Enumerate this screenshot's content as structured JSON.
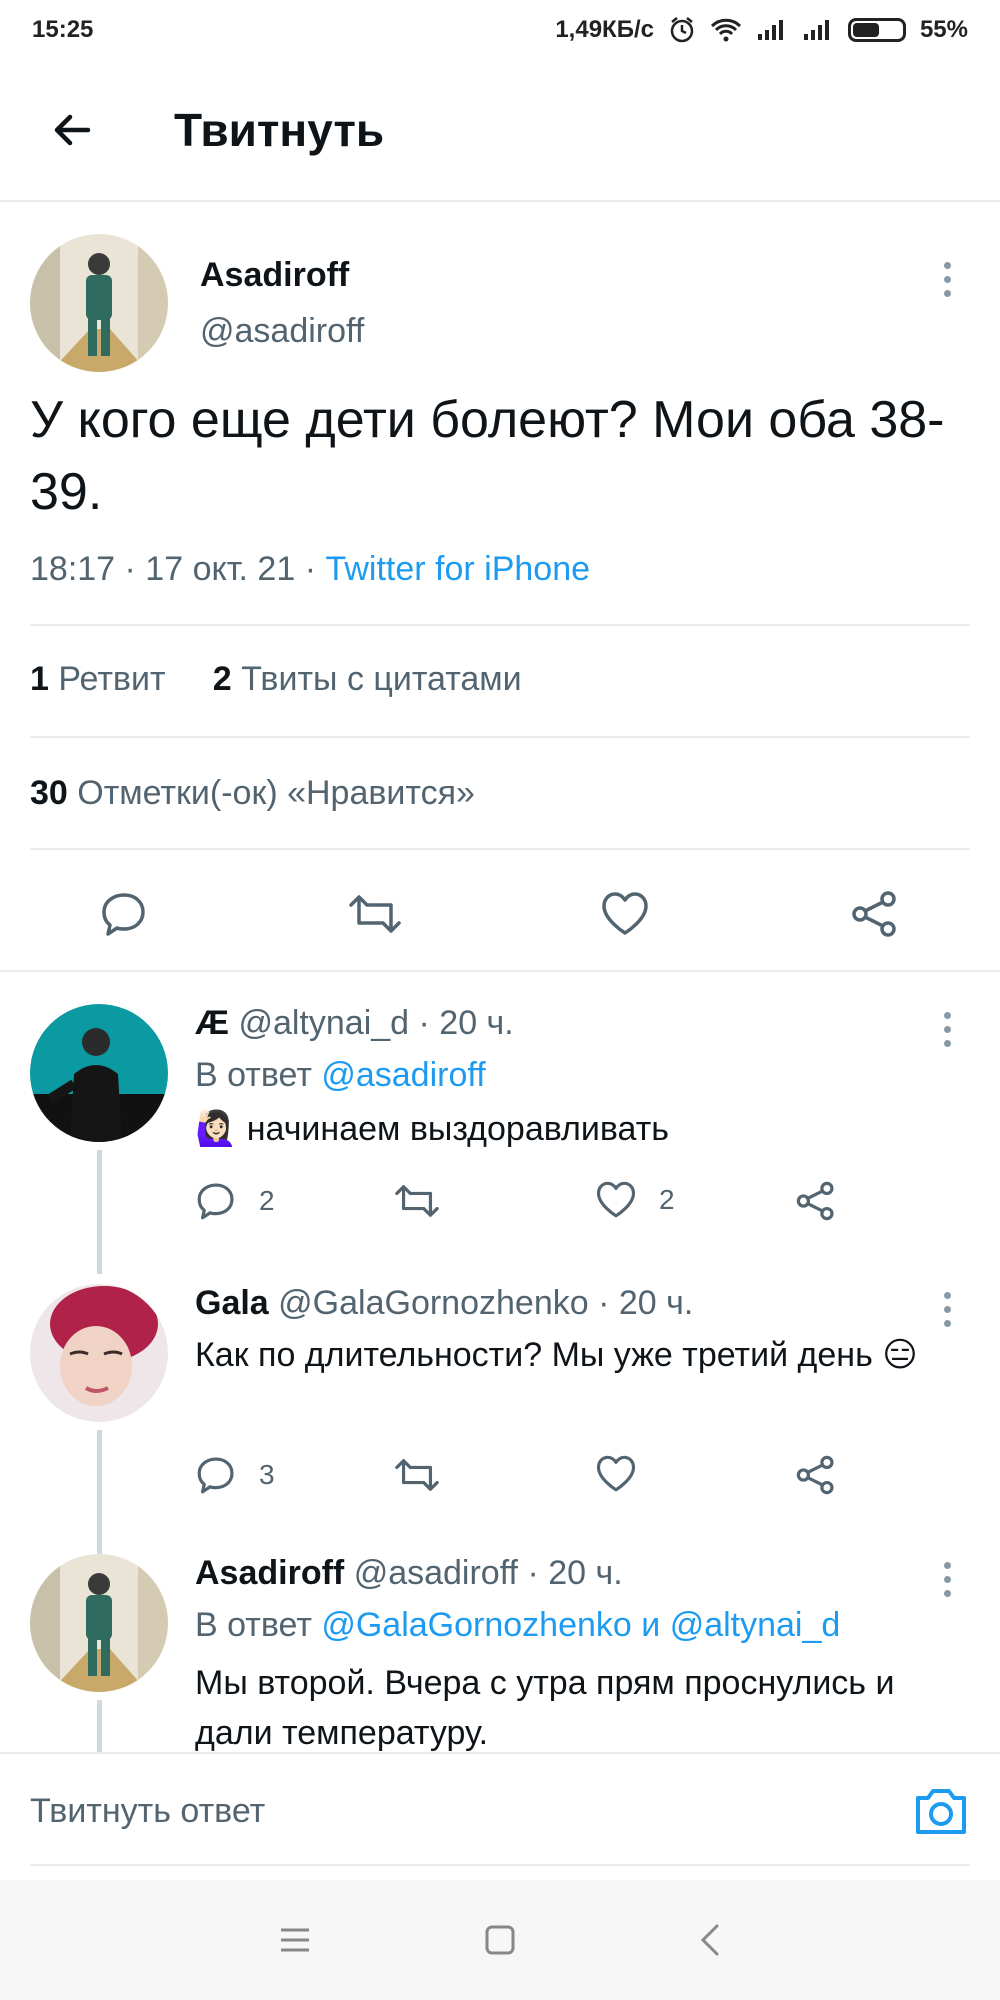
{
  "status_bar": {
    "time": "15:25",
    "net_speed": "1,49КБ/с",
    "battery_percent": "55%",
    "battery_level": 0.55,
    "icons": [
      "alarm-icon",
      "wifi-icon",
      "signal-icon",
      "signal-icon",
      "battery-icon"
    ]
  },
  "header": {
    "title": "Твитнуть",
    "back_icon": "arrow-left-icon"
  },
  "tweet": {
    "author_name": "Asadiroff",
    "author_handle": "@asadiroff",
    "text": "У кого еще дети болеют? Мои оба 38-39.",
    "time_date": "18:17 · 17 окт. 21 · ",
    "source": "Twitter for iPhone",
    "retweets_count": "1",
    "retweets_label": "Ретвит",
    "quotes_count": "2",
    "quotes_label": "Твиты с цитатами",
    "likes_count": "30",
    "likes_label": "Отметки(-ок) «Нравится»"
  },
  "replies": [
    {
      "name": "Æ",
      "handle": "@altynai_d",
      "time": " · 20 ч.",
      "reply_prefix": "В ответ ",
      "reply_to": "@asadiroff",
      "text": "🙋🏻‍♀️ начинаем выздоравливать",
      "reply_count": "2",
      "like_count": "2"
    },
    {
      "name": "Gala",
      "handle": "@GalaGornozhenko",
      "time": " · 20 ч.",
      "text": "Как по длительности? Мы уже третий день 😑",
      "reply_count": "3"
    },
    {
      "name": "Asadiroff",
      "handle": "@asadiroff",
      "time": " · 20 ч.",
      "reply_prefix": "В ответ ",
      "reply_to": "@GalaGornozhenko и @altynai_d",
      "text": "Мы второй. Вчера с утра прям проснулись и дали температуру."
    }
  ],
  "compose": {
    "placeholder": "Твитнуть ответ"
  },
  "colors": {
    "accent": "#1d9bf0",
    "text": "#0f1419",
    "secondary": "#536471",
    "divider": "#e6ecf0"
  }
}
